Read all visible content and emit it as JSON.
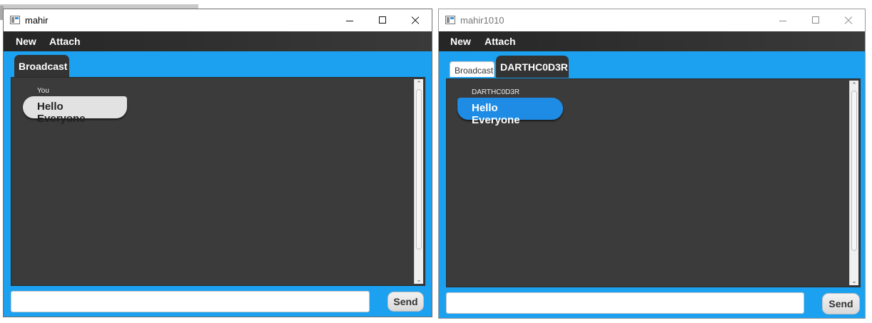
{
  "left_window": {
    "title": "mahir",
    "menu": {
      "new_label": "New",
      "attach_label": "Attach"
    },
    "tabs": [
      {
        "label": "Broadcast",
        "active": true
      }
    ],
    "messages": [
      {
        "sender": "You",
        "text": "Hello Everyone",
        "direction": "sent"
      }
    ],
    "input": {
      "value": "",
      "placeholder": ""
    },
    "send_label": "Send"
  },
  "right_window": {
    "title": "mahir1010",
    "menu": {
      "new_label": "New",
      "attach_label": "Attach"
    },
    "tabs": [
      {
        "label": "Broadcast",
        "active": false
      },
      {
        "label": "DARTHC0D3R",
        "active": true
      }
    ],
    "messages": [
      {
        "sender": "DARTHC0D3R",
        "text": "Hello Everyone",
        "direction": "received"
      }
    ],
    "input": {
      "value": "",
      "placeholder": ""
    },
    "send_label": "Send"
  },
  "colors": {
    "accent_blue": "#1ba1f0",
    "chat_background": "#3b3b3b",
    "received_bubble": "#1e8ce4",
    "sent_bubble": "#e2e2e2",
    "menubar": "#2e2e2e"
  },
  "icons": {
    "app": "java-app-icon",
    "minimize": "minimize-icon",
    "maximize": "maximize-icon",
    "close": "close-icon"
  }
}
